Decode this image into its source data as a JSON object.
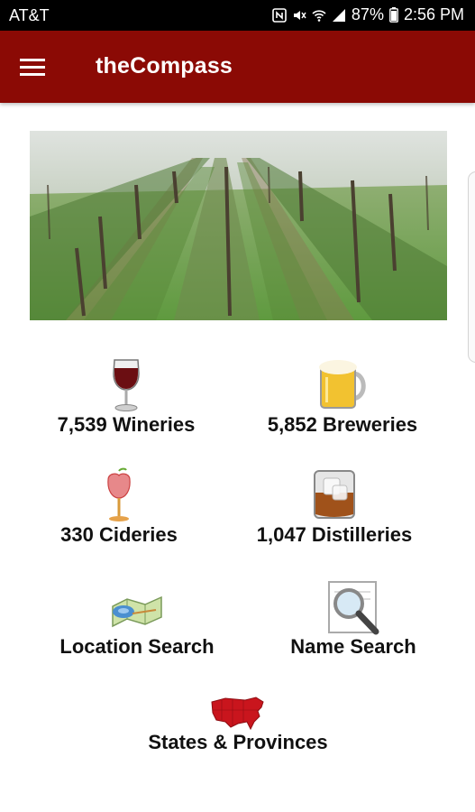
{
  "status_bar": {
    "carrier": "AT&T",
    "battery": "87%",
    "time": "2:56 PM"
  },
  "app_bar": {
    "title": "theCompass",
    "menu_icon": "hamburger-menu-icon"
  },
  "hero": {
    "icon": "vineyard-photo"
  },
  "menu": {
    "wineries": {
      "label": "7,539 Wineries",
      "icon": "wine-glass-icon"
    },
    "breweries": {
      "label": "5,852 Breweries",
      "icon": "beer-mug-icon"
    },
    "cideries": {
      "label": "330 Cideries",
      "icon": "apple-glass-icon"
    },
    "distilleries": {
      "label": "1,047 Distilleries",
      "icon": "whiskey-glass-icon"
    },
    "location_search": {
      "label": "Location Search",
      "icon": "map-icon"
    },
    "name_search": {
      "label": "Name Search",
      "icon": "magnifier-icon"
    },
    "states": {
      "label": "States & Provinces",
      "icon": "us-map-icon"
    }
  },
  "colors": {
    "app_bar": "#8b0a05",
    "status_bar": "#000000",
    "label_text": "#111111"
  }
}
